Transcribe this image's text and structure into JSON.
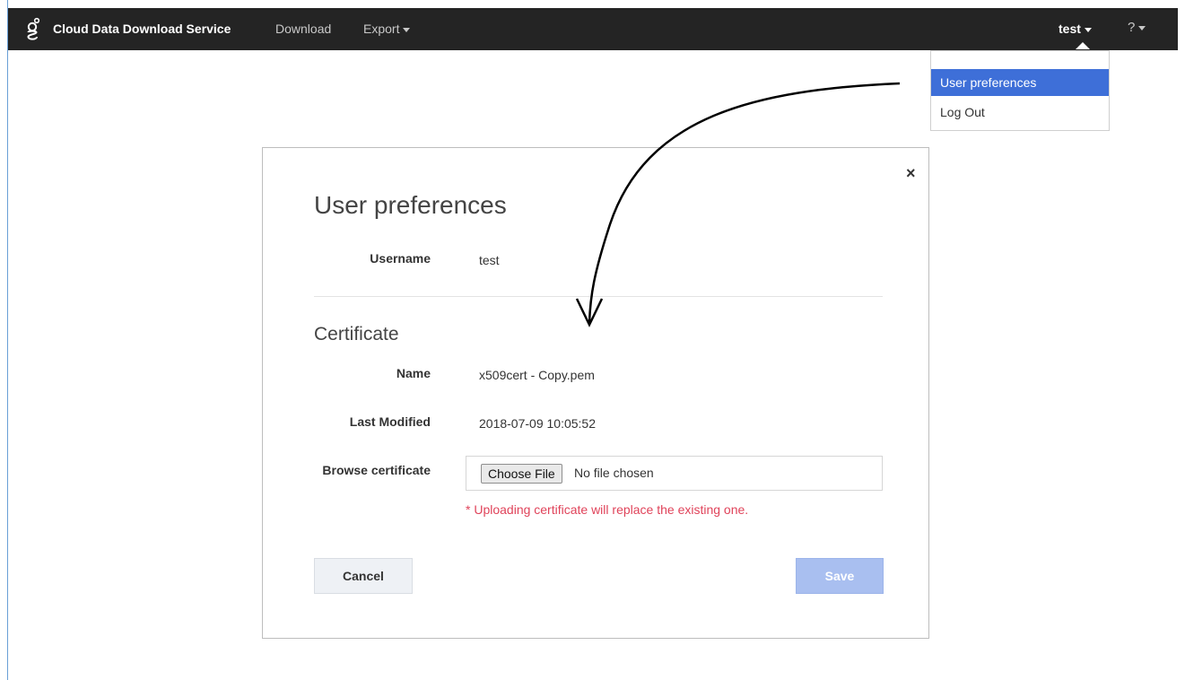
{
  "navbar": {
    "logo_icon": "genesys-logo-icon",
    "brand": "Cloud Data Download Service",
    "download": "Download",
    "export": "Export",
    "user": "test",
    "help": "?"
  },
  "user_menu": {
    "items": [
      {
        "label": "User preferences",
        "active": true
      },
      {
        "label": "Log Out",
        "active": false
      }
    ]
  },
  "modal": {
    "title": "User preferences",
    "close": "×",
    "username_label": "Username",
    "username_value": "test",
    "certificate_title": "Certificate",
    "name_label": "Name",
    "name_value": "x509cert - Copy.pem",
    "modified_label": "Last Modified",
    "modified_value": "2018-07-09 10:05:52",
    "browse_label": "Browse certificate",
    "choose_file": "Choose File",
    "no_file": "No file chosen",
    "warning": "* Uploading certificate will replace the existing one.",
    "cancel": "Cancel",
    "save": "Save"
  },
  "colors": {
    "navbar_bg": "#242424",
    "menu_active": "#3e6fd8",
    "warning": "#e0435a",
    "save_disabled": "#a9bff0"
  }
}
